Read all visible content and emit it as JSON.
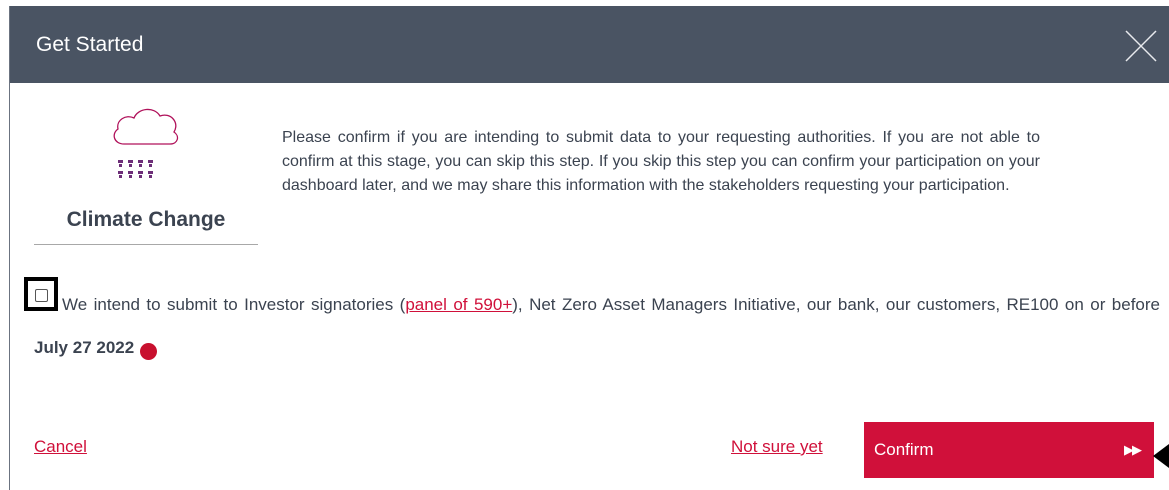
{
  "modal": {
    "title": "Get Started",
    "close_icon": "close-icon"
  },
  "program": {
    "icon": "cloud-rain-icon",
    "name": "Climate Change"
  },
  "intro": {
    "text": "Please confirm if you are intending to submit data to your requesting authorities. If you are not able to confirm at this stage, you can skip this step. If you skip this step you can confirm your participation on your dashboard later, and we may share this information with the stakeholders requesting your participation."
  },
  "consent": {
    "checked": false,
    "text_before_link": "We intend to submit to Investor signatories (",
    "link_text": "panel of 590+",
    "text_after_link": "), Net Zero Asset Managers Initiative, our bank, our customers, RE100 on or before ",
    "deadline": "July 27 2022",
    "help_icon": "help-icon",
    "help_glyph": "?"
  },
  "actions": {
    "cancel_label": "Cancel",
    "not_sure_label": "Not sure yet",
    "confirm_label": "Confirm",
    "confirm_icon": "fast-forward-icon",
    "confirm_glyph": "▶▶"
  },
  "colors": {
    "header_bg": "#4a5463",
    "accent": "#d0103a",
    "text": "#3b4350"
  }
}
